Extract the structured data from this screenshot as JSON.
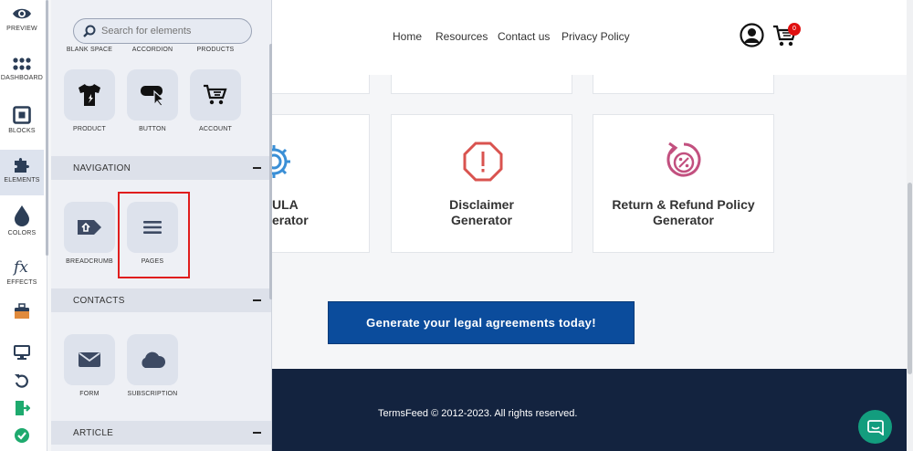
{
  "rail": {
    "items": [
      {
        "label": "PREVIEW",
        "icon": "eye-icon"
      },
      {
        "label": "DASHBOARD",
        "icon": "dots-grid-icon"
      },
      {
        "label": "BLOCKS",
        "icon": "blocks-icon"
      },
      {
        "label": "ELEMENTS",
        "icon": "puzzle-icon"
      },
      {
        "label": "COLORS",
        "icon": "droplet-icon"
      },
      {
        "label": "EFFECTS",
        "icon": "fx-icon"
      }
    ],
    "active": "ELEMENTS"
  },
  "panel": {
    "search_placeholder": "Search for elements",
    "top_captions": [
      "BLANK SPACE",
      "ACCORDION",
      "PRODUCTS"
    ],
    "tiles_row1": [
      {
        "label": "PRODUCT",
        "icon": "tshirt-icon"
      },
      {
        "label": "BUTTON",
        "icon": "button-click-icon"
      },
      {
        "label": "ACCOUNT",
        "icon": "cart-user-icon"
      }
    ],
    "sections": [
      {
        "title": "NAVIGATION",
        "items": [
          {
            "label": "BREADCRUMB",
            "icon": "breadcrumb-icon"
          },
          {
            "label": "PAGES",
            "icon": "menu-lines-icon"
          }
        ]
      },
      {
        "title": "CONTACTS",
        "items": [
          {
            "label": "FORM",
            "icon": "envelope-icon"
          },
          {
            "label": "SUBSCRIPTION",
            "icon": "cloud-icon"
          }
        ]
      },
      {
        "title": "ARTICLE",
        "items": []
      }
    ]
  },
  "site": {
    "nav": [
      "Home",
      "Resources",
      "Contact us",
      "Privacy Policy"
    ],
    "cart_count": "0",
    "cards": [
      {
        "line1": "ULA",
        "line2": "erator",
        "icon": "gear-icon",
        "color": "#3a8fd6"
      },
      {
        "line1": "Disclaimer",
        "line2": "Generator",
        "icon": "octagon-alert-icon",
        "color": "#d9534f"
      },
      {
        "line1": "Return & Refund Policy",
        "line2": "Generator",
        "icon": "percent-refund-icon",
        "color": "#c2507f"
      }
    ],
    "cta_label": "Generate your legal agreements today!",
    "footer_text": "TermsFeed © 2012-2023. All rights reserved."
  },
  "colors": {
    "cta": "#0b4c9c",
    "footer": "#13233f",
    "chat": "#139d7e",
    "highlight": "#e01d1d",
    "badge": "#e01010"
  }
}
